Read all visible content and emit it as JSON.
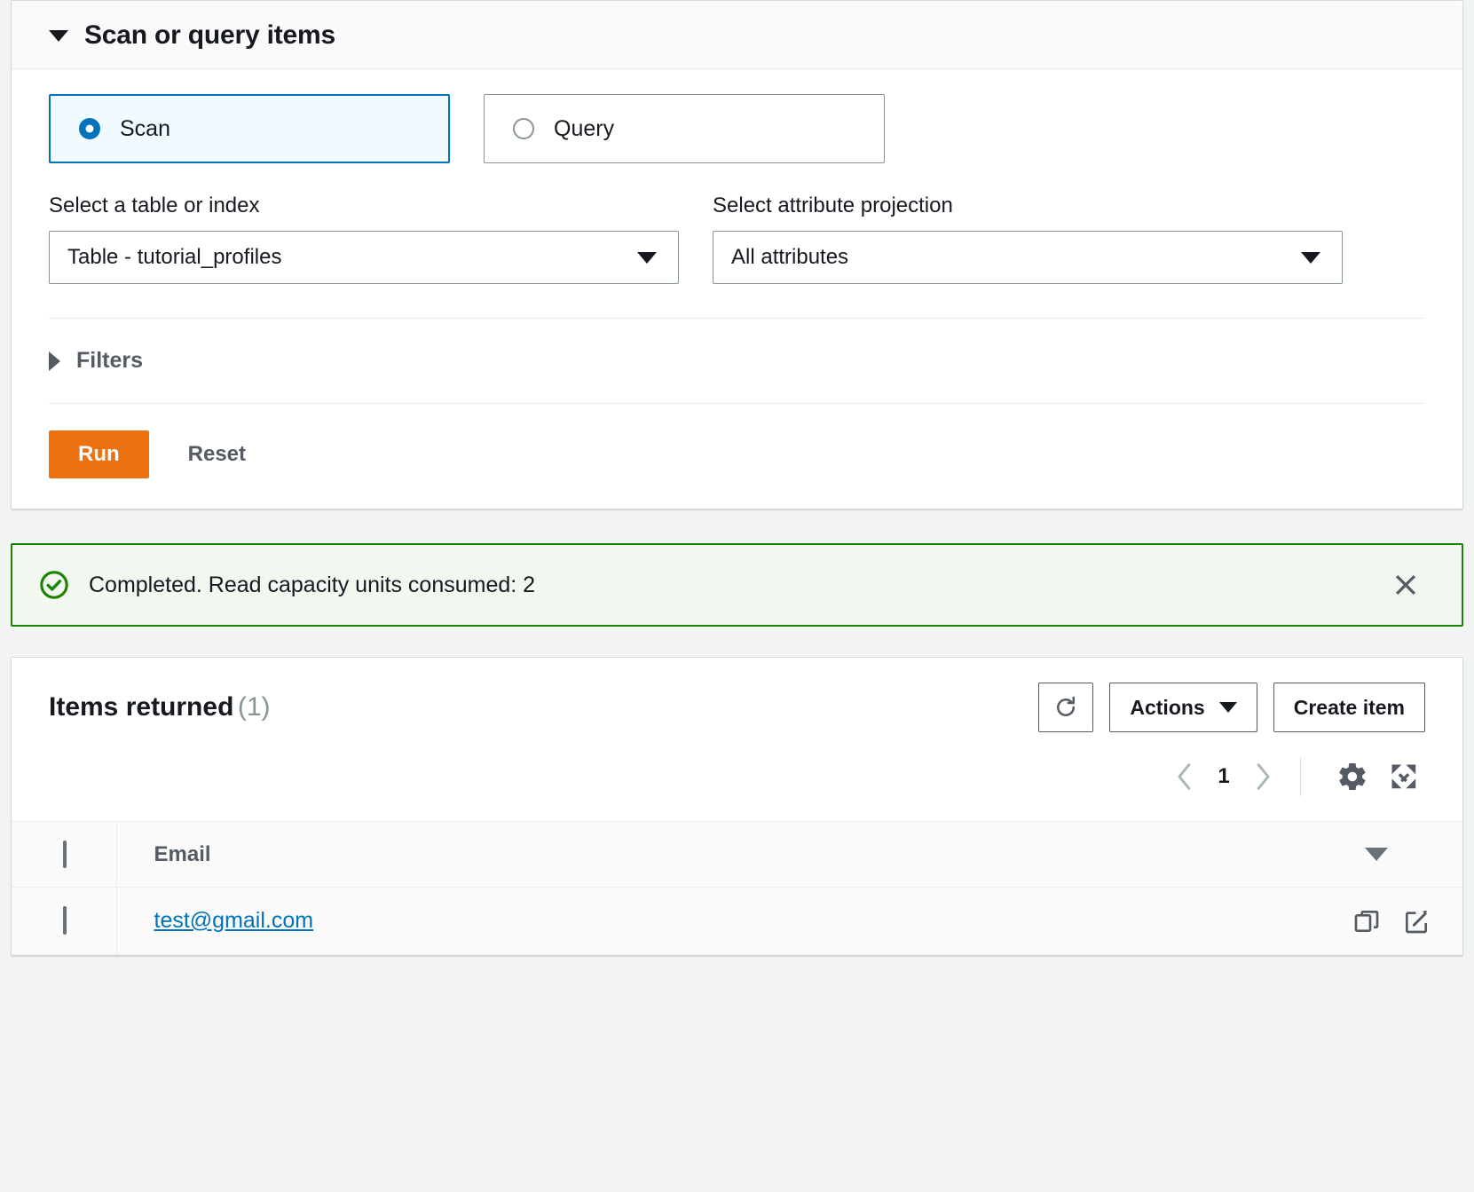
{
  "scan_panel": {
    "title": "Scan or query items",
    "expand_icon": "caret-down-icon",
    "modes": [
      {
        "label": "Scan",
        "selected": true
      },
      {
        "label": "Query",
        "selected": false
      }
    ],
    "fields": [
      {
        "label": "Select a table or index",
        "value": "Table - tutorial_profiles",
        "icon": "chevron-down-icon"
      },
      {
        "label": "Select attribute projection",
        "value": "All attributes",
        "icon": "chevron-down-icon"
      }
    ],
    "filters": {
      "label": "Filters",
      "icon": "caret-right-icon",
      "expanded": false
    },
    "buttons": {
      "run": "Run",
      "reset": "Reset"
    }
  },
  "alert": {
    "icon": "status-success-icon",
    "message": "Completed. Read capacity units consumed: 2",
    "close_icon": "close-icon",
    "border_color": "#1d8102",
    "background_color": "#f2f8f0"
  },
  "results": {
    "title": "Items returned",
    "count": "(1)",
    "buttons": {
      "refresh_icon": "refresh-icon",
      "actions": "Actions",
      "actions_caret": "caret-down-icon",
      "create_item": "Create item"
    },
    "pagination": {
      "prev_icon": "chevron-left-icon",
      "page": "1",
      "next_icon": "chevron-right-icon",
      "settings_icon": "gear-icon",
      "fullscreen_icon": "expand-icon"
    },
    "table": {
      "columns": [
        "Email"
      ],
      "sort_icon": "sort-descending-icon",
      "rows": [
        {
          "email": "test@gmail.com",
          "copy_icon": "copy-icon",
          "edit_icon": "edit-icon"
        }
      ]
    }
  },
  "theme": {
    "accent_orange": "#ec7211",
    "link_blue": "#0073bb",
    "success_green": "#1d8102",
    "selected_tile_bg": "#f1faff"
  }
}
